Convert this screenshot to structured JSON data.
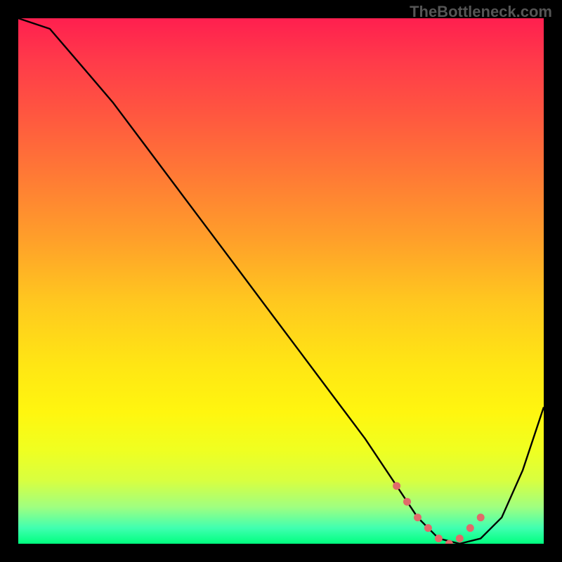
{
  "watermark": "TheBottleneck.com",
  "chart_data": {
    "type": "line",
    "title": "",
    "xlabel": "",
    "ylabel": "",
    "xlim": [
      0,
      100
    ],
    "ylim": [
      0,
      100
    ],
    "series": [
      {
        "name": "bottleneck-curve",
        "x": [
          0,
          6,
          12,
          18,
          24,
          30,
          36,
          42,
          48,
          54,
          60,
          66,
          72,
          76,
          80,
          84,
          88,
          92,
          96,
          100
        ],
        "y": [
          105,
          98,
          91,
          84,
          76,
          68,
          60,
          52,
          44,
          36,
          28,
          20,
          11,
          5,
          1,
          0,
          1,
          5,
          14,
          26
        ]
      }
    ],
    "marker_points": {
      "name": "optimal-region",
      "x": [
        72,
        74,
        76,
        78,
        80,
        82,
        84,
        86,
        88
      ],
      "y": [
        11,
        8,
        5,
        3,
        1,
        0,
        1,
        3,
        5
      ]
    },
    "gradient_stops": [
      {
        "pct": 0,
        "color": "#ff1f4f"
      },
      {
        "pct": 50,
        "color": "#ffd000"
      },
      {
        "pct": 90,
        "color": "#f0ff20"
      },
      {
        "pct": 100,
        "color": "#00ff7f"
      }
    ]
  }
}
